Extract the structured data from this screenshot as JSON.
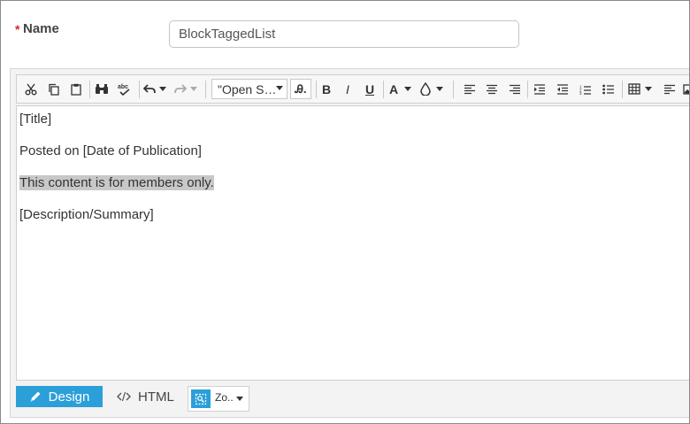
{
  "form": {
    "name_label": "Name",
    "required_mark": "*",
    "name_value": "BlockTaggedList"
  },
  "toolbar": {
    "font_family": "\"Open S…",
    "font_size": "Ꭿ.",
    "bold_label": "B",
    "italic_label": "I",
    "underline_label": "U",
    "font_color_label": "A"
  },
  "content": {
    "lines": [
      "[Title]",
      "Posted on [Date of Publication]",
      "This content is for members only.",
      "[Description/Summary]"
    ]
  },
  "modes": {
    "design_label": "Design",
    "html_label": "HTML",
    "zoom_label": "Zo.."
  },
  "colors": {
    "accent": "#2b9fd8",
    "required": "#d9262f",
    "highlight": "#c8c8c8"
  }
}
